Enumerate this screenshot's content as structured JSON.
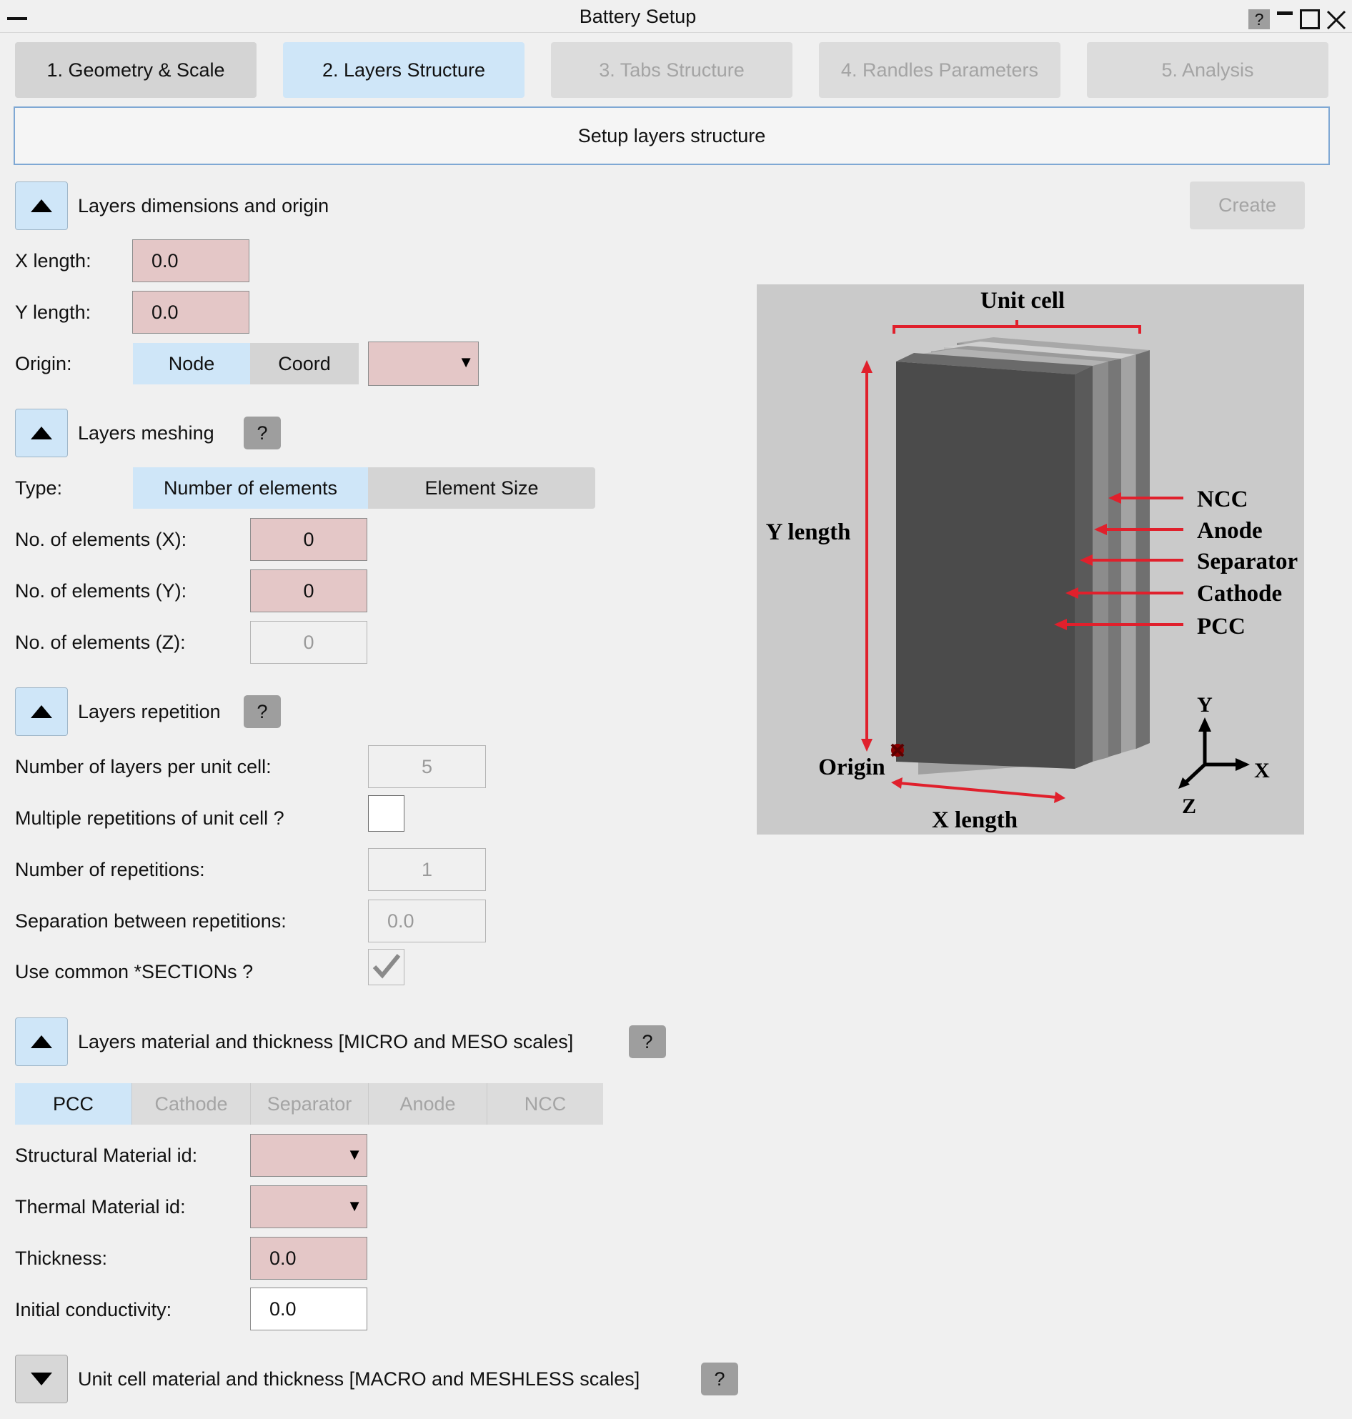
{
  "window": {
    "title": "Battery Setup",
    "help_label": "?"
  },
  "tabs": [
    {
      "label": "1. Geometry & Scale"
    },
    {
      "label": "2. Layers Structure"
    },
    {
      "label": "3. Tabs Structure"
    },
    {
      "label": "4. Randles Parameters"
    },
    {
      "label": "5. Analysis"
    }
  ],
  "banner": "Setup layers structure",
  "create_label": "Create",
  "section_dimensions": {
    "title": "Layers dimensions and origin",
    "x_label": "X length:",
    "x_value": "0.0",
    "y_label": "Y length:",
    "y_value": "0.0",
    "origin_label": "Origin:",
    "origin_options": [
      "Node",
      "Coord"
    ],
    "origin_selected": "Node"
  },
  "section_meshing": {
    "title": "Layers meshing",
    "help": "?",
    "type_label": "Type:",
    "type_options": [
      "Number of elements",
      "Element Size"
    ],
    "nx_label": "No. of elements (X):",
    "nx_value": "0",
    "ny_label": "No. of elements (Y):",
    "ny_value": "0",
    "nz_label": "No. of elements (Z):",
    "nz_value": "0"
  },
  "section_repetition": {
    "title": "Layers repetition",
    "help": "?",
    "layers_label": "Number of layers per unit cell:",
    "layers_value": "5",
    "multiple_label": "Multiple repetitions of unit cell ?",
    "multiple_checked": false,
    "reps_label": "Number of repetitions:",
    "reps_value": "1",
    "sep_label": "Separation between repetitions:",
    "sep_value": "0.0",
    "common_label": "Use common *SECTIONs ?",
    "common_checked": true
  },
  "section_material": {
    "title": "Layers material and thickness [MICRO and MESO scales]",
    "help": "?",
    "layer_tabs": [
      "PCC",
      "Cathode",
      "Separator",
      "Anode",
      "NCC"
    ],
    "struct_label": "Structural Material id:",
    "thermal_label": "Thermal Material id:",
    "thickness_label": "Thickness:",
    "thickness_value": "0.0",
    "cond_label": "Initial conductivity:",
    "cond_value": "0.0"
  },
  "section_unitcell": {
    "title": "Unit cell material and thickness [MACRO and MESHLESS scales]",
    "help": "?"
  },
  "diagram": {
    "unit_cell": "Unit cell",
    "y_length": "Y length",
    "x_length": "X length",
    "origin": "Origin",
    "layers": [
      "NCC",
      "Anode",
      "Separator",
      "Cathode",
      "PCC"
    ],
    "axis_y": "Y",
    "axis_x": "X",
    "axis_z": "Z"
  },
  "colors": {
    "tab_active": "#cfe6f8",
    "required_field": "#e4c7c7",
    "diagram_red": "#e0202c"
  }
}
